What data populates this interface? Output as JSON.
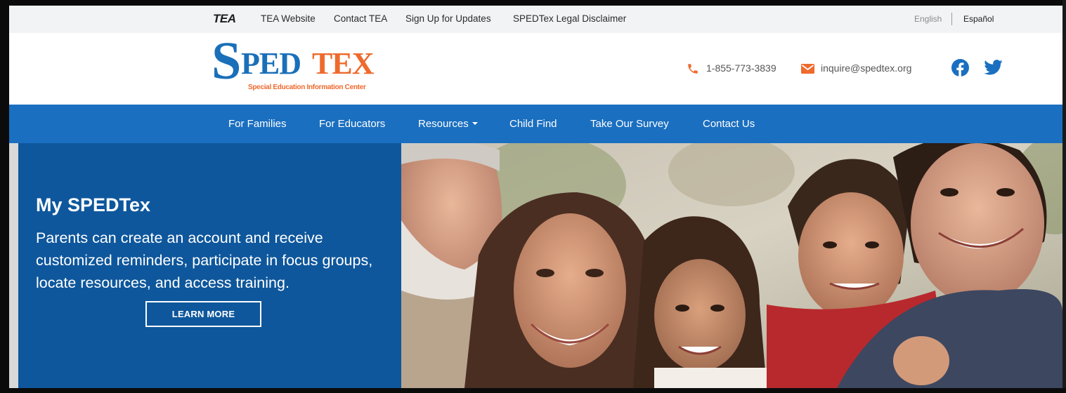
{
  "utility_bar": {
    "tea_logo": "TEA",
    "links": [
      "TEA Website",
      "Contact TEA",
      "Sign Up for Updates",
      "SPEDTex Legal Disclaimer"
    ],
    "language_english": "English",
    "language_spanish": "Español"
  },
  "header": {
    "logo": {
      "s": "S",
      "ped": "PED",
      "tex": "TEX",
      "subtitle": "Special Education Information Center"
    },
    "phone": "1-855-773-3839",
    "email": "inquire@spedtex.org",
    "icons": [
      "phone-icon",
      "mail-icon",
      "facebook-icon",
      "twitter-icon"
    ]
  },
  "nav": {
    "items": [
      "For Families",
      "For Educators",
      "Resources",
      "Child Find",
      "Take Our Survey",
      "Contact Us"
    ]
  },
  "hero": {
    "title": "My SPEDTex",
    "body": "Parents can create an account and receive customized reminders, participate in focus groups, locate resources, and access training.",
    "button": "LEARN MORE",
    "photo_description_icon": "family-photo"
  },
  "colors": {
    "brand_blue": "#1a6fb9",
    "brand_orange": "#ee6a2d",
    "nav_blue": "#1a6fc0",
    "hero_panel": "#0e579c",
    "utility_bg": "#f2f3f4"
  }
}
